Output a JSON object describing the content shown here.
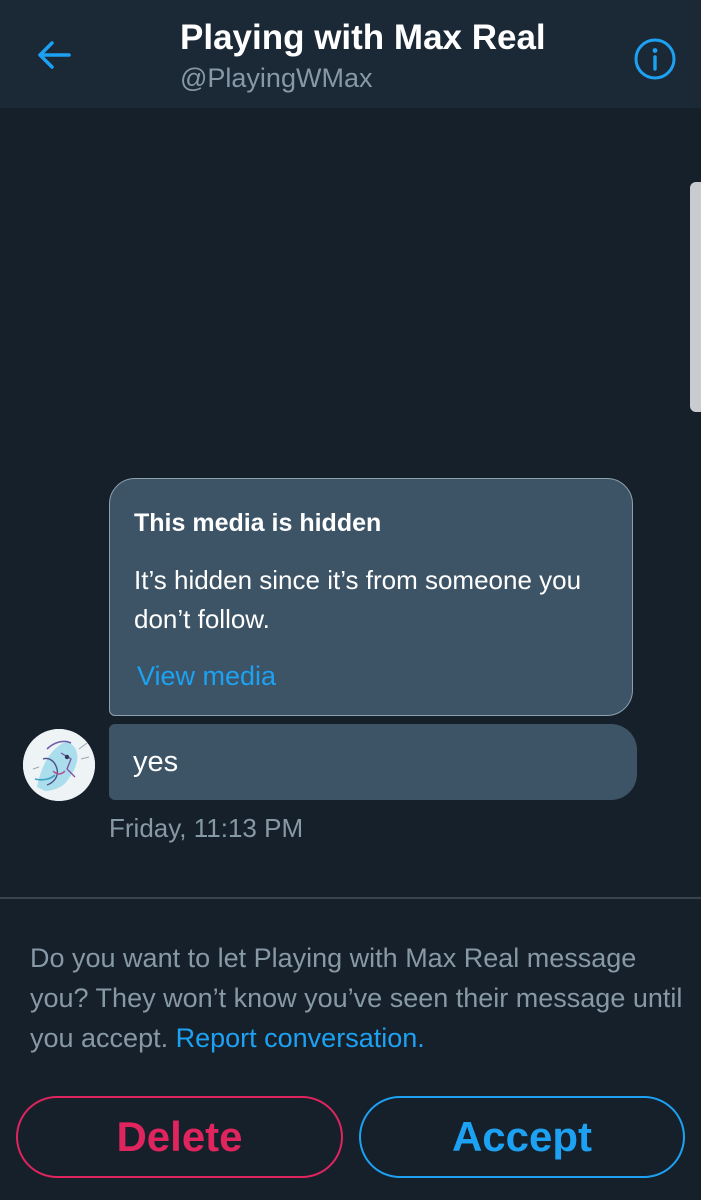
{
  "header": {
    "title": "Playing with Max Real",
    "handle": "@PlayingWMax",
    "back_icon": "arrow-left-icon",
    "info_icon": "info-icon"
  },
  "media_notice": {
    "title": "This media is hidden",
    "text": "It’s hidden since it’s from someone you don’t follow.",
    "action": "View media"
  },
  "message": {
    "text": "yes",
    "timestamp": "Friday, 11:13 PM"
  },
  "request": {
    "prompt": "Do you want to let Playing with Max Real message you? They won’t know you’ve seen their message until you accept.",
    "report_link": "Report conversation."
  },
  "actions": {
    "delete_label": "Delete",
    "accept_label": "Accept"
  },
  "colors": {
    "background": "#15202b",
    "header_background": "#1b2836",
    "bubble": "#3d5466",
    "accent_blue": "#1da1f2",
    "delete_red": "#e0245e",
    "muted_text": "#8899a6"
  }
}
